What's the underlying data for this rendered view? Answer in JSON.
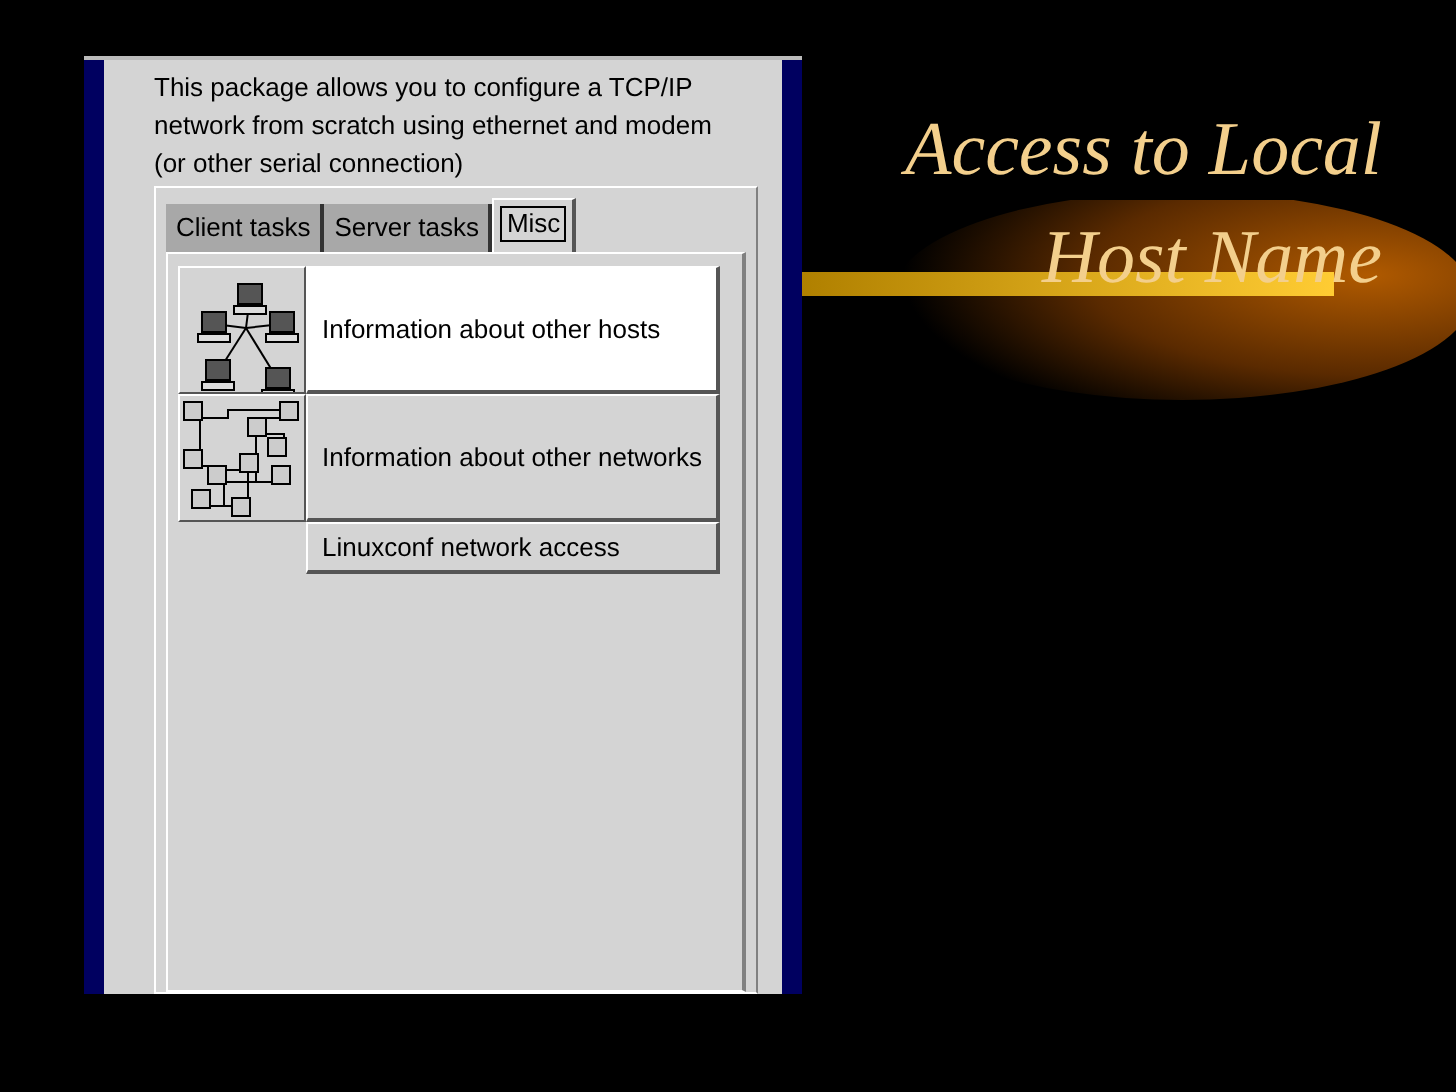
{
  "slide": {
    "title_lines": [
      "Access to Local",
      "Host Name"
    ]
  },
  "description": "This package allows you to configure a TCP/IP network from scratch using ethernet and modem (or other serial connection)",
  "tabs": [
    {
      "label": "Client tasks",
      "selected": false
    },
    {
      "label": "Server tasks",
      "selected": false
    },
    {
      "label": "Misc",
      "selected": true
    }
  ],
  "items": [
    {
      "kind": "hosts",
      "label": "Information about other hosts",
      "selected": true
    },
    {
      "kind": "networks",
      "label": "Information about other networks",
      "selected": false
    },
    {
      "kind": "plain",
      "label": "Linuxconf network access",
      "selected": false
    }
  ]
}
